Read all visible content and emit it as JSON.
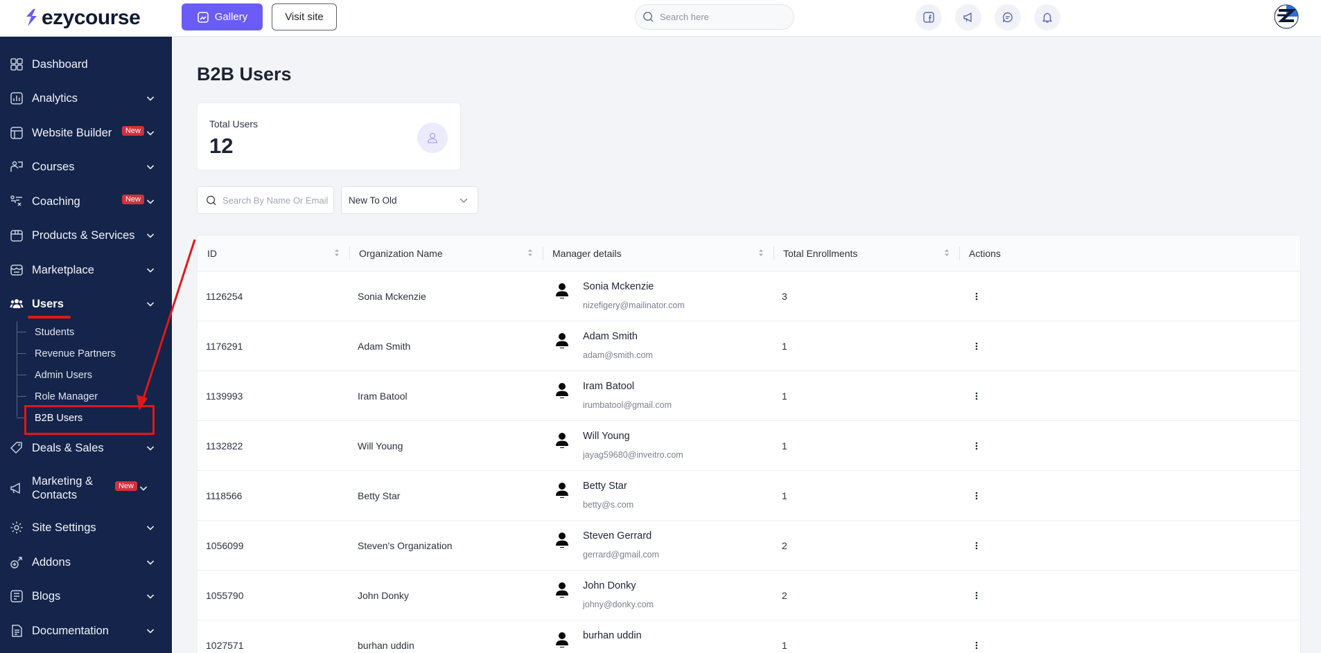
{
  "brand": {
    "name": "ezycourse",
    "accent": "#6a5cf6",
    "sidebar_bg": "#14244a"
  },
  "topbar": {
    "gallery_label": "Gallery",
    "visit_label": "Visit site",
    "search_placeholder": "Search here",
    "icons": [
      "facebook-icon",
      "megaphone-icon",
      "chat-icon",
      "bell-icon"
    ]
  },
  "sidebar": {
    "items": [
      {
        "label": "Dashboard",
        "icon": "dashboard-icon",
        "chevron": false,
        "badge": ""
      },
      {
        "label": "Analytics",
        "icon": "analytics-icon",
        "chevron": true,
        "badge": ""
      },
      {
        "label": "Website Builder",
        "icon": "website-builder-icon",
        "chevron": true,
        "badge": "New"
      },
      {
        "label": "Courses",
        "icon": "courses-icon",
        "chevron": true,
        "badge": ""
      },
      {
        "label": "Coaching",
        "icon": "coaching-icon",
        "chevron": true,
        "badge": "New"
      },
      {
        "label": "Products & Services",
        "icon": "products-icon",
        "chevron": true,
        "badge": ""
      },
      {
        "label": "Marketplace",
        "icon": "marketplace-icon",
        "chevron": true,
        "badge": ""
      },
      {
        "label": "Users",
        "icon": "users-icon",
        "chevron": true,
        "badge": ""
      },
      {
        "label": "Deals & Sales",
        "icon": "deals-icon",
        "chevron": true,
        "badge": ""
      },
      {
        "label": "Marketing & Contacts",
        "icon": "marketing-icon",
        "chevron": true,
        "badge": "New"
      },
      {
        "label": "Site Settings",
        "icon": "settings-icon",
        "chevron": true,
        "badge": ""
      },
      {
        "label": "Addons",
        "icon": "addons-icon",
        "chevron": true,
        "badge": ""
      },
      {
        "label": "Blogs",
        "icon": "blogs-icon",
        "chevron": true,
        "badge": ""
      },
      {
        "label": "Documentation",
        "icon": "documentation-icon",
        "chevron": true,
        "badge": ""
      }
    ],
    "users_submenu": [
      "Students",
      "Revenue Partners",
      "Admin Users",
      "Role Manager",
      "B2B Users"
    ]
  },
  "main": {
    "title": "B2B Users",
    "stat": {
      "label": "Total Users",
      "value": "12"
    },
    "filters": {
      "search_placeholder": "Search By Name Or Email",
      "sort_value": "New To Old"
    },
    "table": {
      "columns": [
        "ID",
        "Organization Name",
        "Manager details",
        "Total Enrollments",
        "Actions"
      ],
      "rows": [
        {
          "id": "1126254",
          "org": "Sonia Mckenzie",
          "manager": "Sonia Mckenzie",
          "email": "nizefigery@mailinator.com",
          "enrollments": "3"
        },
        {
          "id": "1176291",
          "org": "Adam Smith",
          "manager": "Adam Smith",
          "email": "adam@smith.com",
          "enrollments": "1"
        },
        {
          "id": "1139993",
          "org": "Iram Batool",
          "manager": "Iram Batool",
          "email": "irumbatool@gmail.com",
          "enrollments": "1"
        },
        {
          "id": "1132822",
          "org": "Will Young",
          "manager": "Will Young",
          "email": "jayag59680@inveitro.com",
          "enrollments": "1"
        },
        {
          "id": "1118566",
          "org": "Betty Star",
          "manager": "Betty Star",
          "email": "betty@s.com",
          "enrollments": "1"
        },
        {
          "id": "1056099",
          "org": "Steven's Organization",
          "manager": "Steven Gerrard",
          "email": "gerrard@gmail.com",
          "enrollments": "2"
        },
        {
          "id": "1055790",
          "org": "John Donky",
          "manager": "John Donky",
          "email": "johny@donky.com",
          "enrollments": "2"
        },
        {
          "id": "1027571",
          "org": "burhan uddin",
          "manager": "burhan uddin",
          "email": "",
          "enrollments": "1"
        }
      ]
    }
  },
  "annotation": {
    "color": "#e01818"
  }
}
